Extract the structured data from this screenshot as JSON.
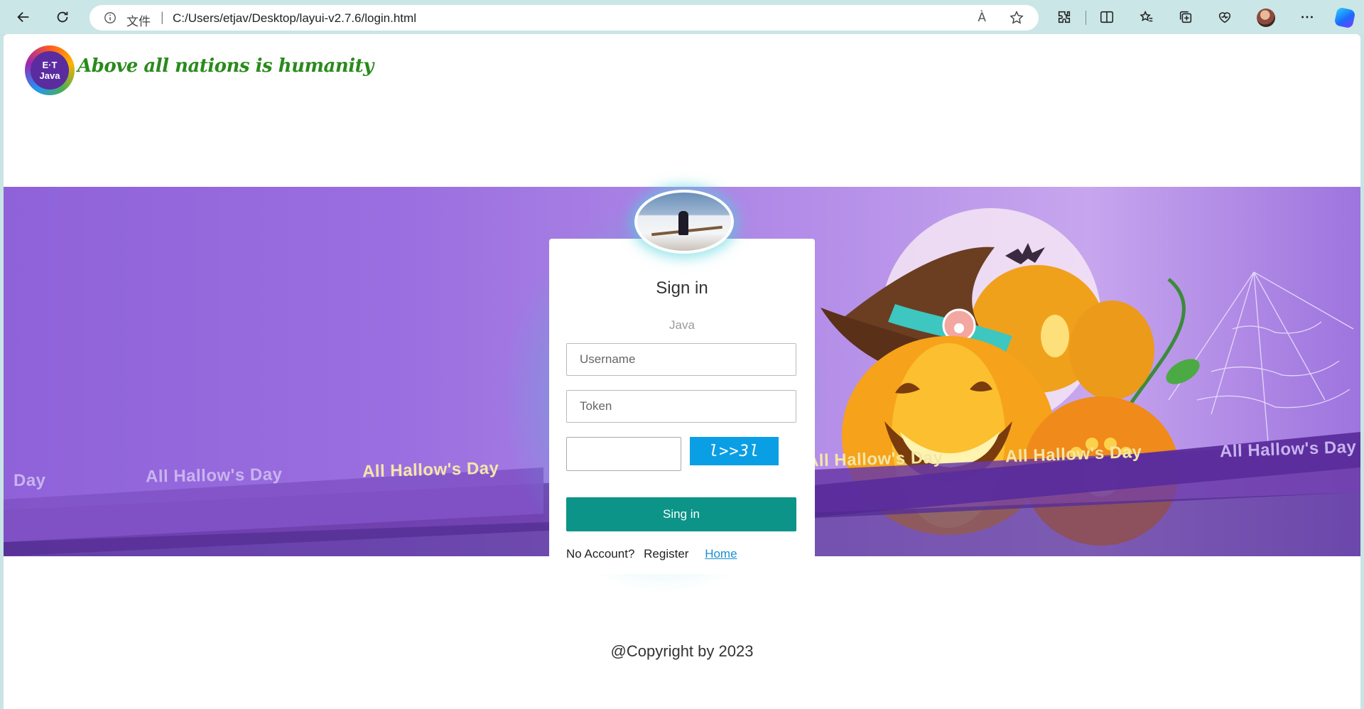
{
  "browser": {
    "protocol_label": "文件",
    "separator": "|",
    "url": "C:/Users/etjav/Desktop/layui-v2.7.6/login.html",
    "read_aloud": "À",
    "icons": [
      "back-icon",
      "refresh-icon",
      "info-icon",
      "read-aloud-icon",
      "favorite-star-icon",
      "extensions-icon",
      "split-screen-icon",
      "favorites-icon",
      "collections-icon",
      "browser-essentials-icon",
      "profile-avatar",
      "more-icon",
      "copilot-icon"
    ]
  },
  "header": {
    "logo_line1": "E·T",
    "logo_line2": "Java",
    "slogan": "Above all nations is humanity"
  },
  "banner": {
    "ribbon_texts": [
      "Day",
      "All Hallow's Day",
      "All Hallow's Day",
      "All Hallow's Day",
      "All Hallow's Day",
      "All Hallow's Day"
    ],
    "colors": {
      "purple": "#9b6fe0",
      "pumpkin": "#f6a21a",
      "hat": "#6b3e22",
      "band": "#3ec6c0"
    }
  },
  "login": {
    "title": "Sign in",
    "subtitle": "Java",
    "username_placeholder": "Username",
    "token_placeholder": "Token",
    "captcha_text": "l>>3l",
    "submit_label": "Sing in",
    "no_account_text": "No Account?",
    "register_label": "Register",
    "home_label": "Home",
    "accent": "#0d9488",
    "captcha_color": "#0a9fe4"
  },
  "footer": {
    "copyright": "@Copyright by 2023"
  }
}
